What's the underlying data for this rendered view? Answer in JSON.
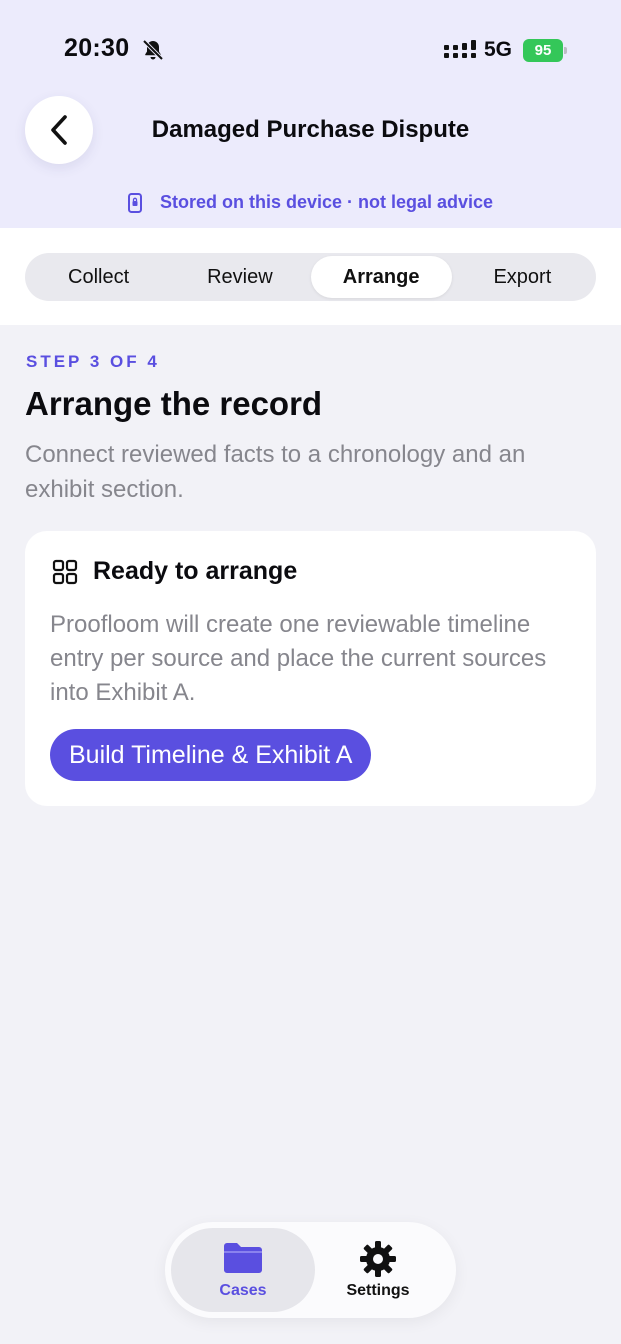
{
  "status_bar": {
    "time": "20:30",
    "network": "5G",
    "battery": "95"
  },
  "nav": {
    "title": "Damaged Purchase Dispute",
    "storage_note": "Stored on this device · not legal advice"
  },
  "segments": [
    {
      "label": "Collect",
      "active": false
    },
    {
      "label": "Review",
      "active": false
    },
    {
      "label": "Arrange",
      "active": true
    },
    {
      "label": "Export",
      "active": false
    }
  ],
  "content": {
    "step_label": "STEP 3 OF 4",
    "title": "Arrange the record",
    "description": "Connect reviewed facts to a chronology and an exhibit section."
  },
  "card": {
    "icon": "grid-icon",
    "title": "Ready to arrange",
    "body": "Proofloom will create one reviewable timeline entry per source and place the current sources into Exhibit A.",
    "button_label": "Build Timeline & Exhibit A"
  },
  "tab_bar": {
    "tabs": [
      {
        "label": "Cases",
        "icon": "folder-icon",
        "active": true
      },
      {
        "label": "Settings",
        "icon": "gear-icon",
        "active": false
      }
    ]
  },
  "colors": {
    "accent": "#5a4fe0",
    "header_bg": "#ecebfc",
    "battery": "#34c759"
  }
}
